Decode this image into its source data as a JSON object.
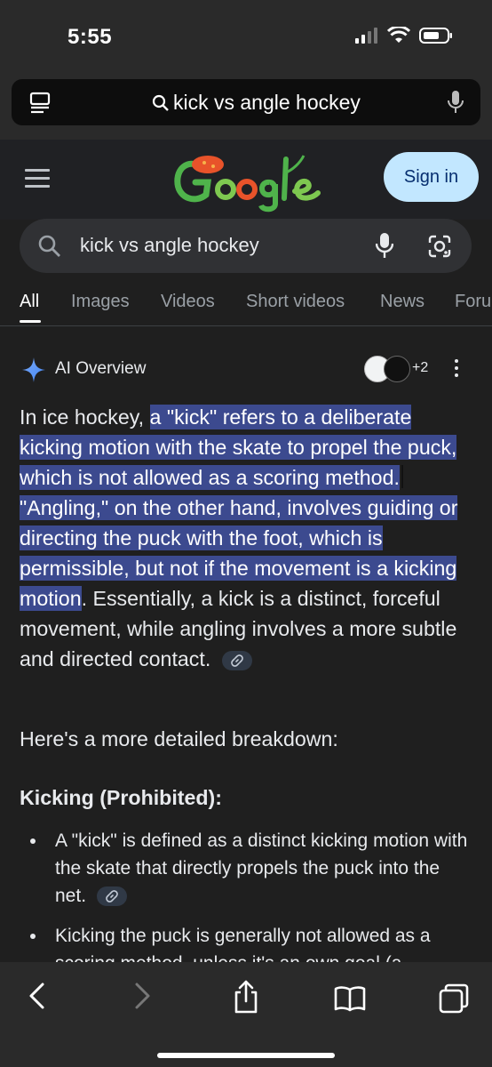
{
  "status": {
    "time": "5:55"
  },
  "browser": {
    "url_text": "kick vs angle hockey"
  },
  "header": {
    "signin_label": "Sign in",
    "logo_alt": "Google"
  },
  "search": {
    "query": "kick vs angle hockey"
  },
  "tabs": [
    "All",
    "Images",
    "Videos",
    "Short videos",
    "News",
    "Foru"
  ],
  "ai_overview": {
    "title": "AI Overview",
    "sources_more": "+2",
    "intro_lead": "In ice hockey,",
    "highlight_1": "a \"kick\" refers to a deliberate kicking motion with the skate to propel the puck, which is not allowed as a scoring method.",
    "highlight_2": "\"Angling,\" on the other hand, involves guiding or directing the puck with the foot, which is permissible, but not if the movement is a kicking motion",
    "intro_tail": ". Essentially, a kick is a distinct, forceful movement, while angling involves a more subtle and directed contact.",
    "breakdown_intro": "Here's a more detailed breakdown:",
    "section_heading": "Kicking (Prohibited):",
    "bullets": [
      "A \"kick\" is defined as a distinct kicking motion with the skate that directly propels the puck into the net.",
      "Kicking the puck is generally not allowed as a scoring method, unless it's an own goal (a"
    ]
  },
  "colors": {
    "highlight": "#3c4a8f",
    "signin_bg": "#c2e7ff",
    "link_chip": "#303946"
  }
}
